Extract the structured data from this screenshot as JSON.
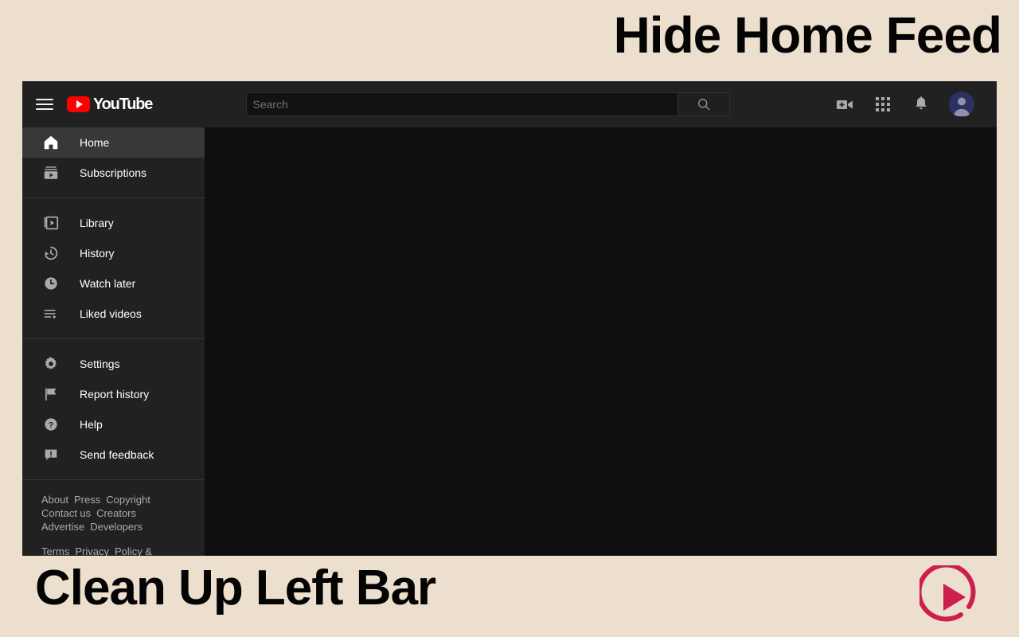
{
  "promo": {
    "headline_top": "Hide Home Feed",
    "headline_bottom": "Clean Up Left Bar",
    "background_color": "#ecdfcd",
    "text_color": "#040404",
    "play_logo_color": "#cc1f4f",
    "play_logo_name": "play-button-logo"
  },
  "masthead": {
    "menu_icon": "hamburger-menu-icon",
    "logo_text": "YouTube",
    "logo_color": "#ff0000",
    "search": {
      "placeholder": "Search",
      "value": "",
      "button_icon": "search-icon"
    },
    "actions": [
      {
        "name": "create-video-icon",
        "label": "Create"
      },
      {
        "name": "apps-grid-icon",
        "label": "YouTube apps"
      },
      {
        "name": "notifications-bell-icon",
        "label": "Notifications"
      }
    ],
    "avatar": {
      "name": "account-avatar",
      "background_color": "#2b3160"
    }
  },
  "sidebar": {
    "sections": [
      {
        "items": [
          {
            "label": "Home",
            "icon": "home-icon",
            "active": true
          },
          {
            "label": "Subscriptions",
            "icon": "subscriptions-icon",
            "active": false
          }
        ]
      },
      {
        "items": [
          {
            "label": "Library",
            "icon": "library-icon",
            "active": false
          },
          {
            "label": "History",
            "icon": "history-icon",
            "active": false
          },
          {
            "label": "Watch later",
            "icon": "clock-icon",
            "active": false
          },
          {
            "label": "Liked videos",
            "icon": "liked-videos-icon",
            "active": false
          }
        ]
      },
      {
        "items": [
          {
            "label": "Settings",
            "icon": "gear-icon",
            "active": false
          },
          {
            "label": "Report history",
            "icon": "flag-icon",
            "active": false
          },
          {
            "label": "Help",
            "icon": "help-icon",
            "active": false
          },
          {
            "label": "Send feedback",
            "icon": "feedback-icon",
            "active": false
          }
        ]
      }
    ],
    "footer": {
      "group_one": [
        [
          "About",
          "Press",
          "Copyright"
        ],
        [
          "Contact us",
          "Creators"
        ],
        [
          "Advertise",
          "Developers"
        ]
      ],
      "group_two": [
        [
          "Terms",
          "Privacy",
          "Policy & Safety"
        ]
      ]
    }
  }
}
